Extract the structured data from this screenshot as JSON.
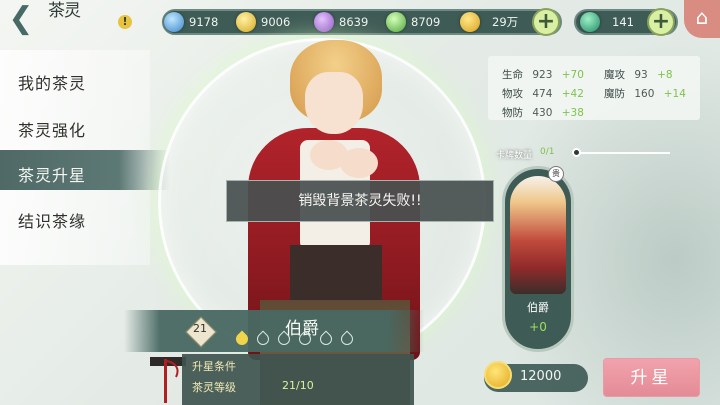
{
  "header": {
    "title": "茶灵",
    "back_label": "❮",
    "alert_label": "!",
    "home_label": "⌂"
  },
  "resources": [
    {
      "icon": "blue-gem-icon",
      "color": "#5aa8e0",
      "value": "9178"
    },
    {
      "icon": "yellow-gem-icon",
      "color": "#e8c23a",
      "value": "9006"
    },
    {
      "icon": "purple-gem-icon",
      "color": "#a262d6",
      "value": "8639"
    },
    {
      "icon": "green-gem-icon",
      "color": "#67c24a",
      "value": "8709"
    },
    {
      "icon": "gold-coin-icon",
      "color": "#e9b22c",
      "value": "29万"
    }
  ],
  "ticket": {
    "icon": "green-ticket-icon",
    "color": "#2fa07a",
    "value": "141"
  },
  "plus_label": "+",
  "side_menu": {
    "items": [
      {
        "label": "我的茶灵"
      },
      {
        "label": "茶灵强化"
      },
      {
        "label": "茶灵升星"
      },
      {
        "label": "结识茶缘"
      }
    ],
    "active_index": 2
  },
  "toast": {
    "message": "销毁背景茶灵失败!!"
  },
  "character": {
    "name": "伯爵",
    "level": "21",
    "stars_total": 6,
    "stars_filled": 1
  },
  "conditions": {
    "title": "升星条件",
    "label": "茶灵等级",
    "value": "21/10"
  },
  "stats": [
    {
      "label": "生命",
      "value": "923",
      "bonus": "+70"
    },
    {
      "label": "魔攻",
      "value": "93",
      "bonus": "+8"
    },
    {
      "label": "物攻",
      "value": "474",
      "bonus": "+42"
    },
    {
      "label": "魔防",
      "value": "160",
      "bonus": "+14"
    },
    {
      "label": "物防",
      "value": "430",
      "bonus": "+38"
    }
  ],
  "card_count": {
    "label": "卡牌数量",
    "value": "0/1",
    "progress": 0
  },
  "card": {
    "name": "伯爵",
    "plus": "+0",
    "badge": "贵"
  },
  "cost": {
    "value": "12000"
  },
  "star_button": {
    "label": "升星"
  },
  "colors": {
    "accent_green": "#7ec24c",
    "panel_dark": "#3f5b56",
    "star_button": "#e48b96"
  }
}
